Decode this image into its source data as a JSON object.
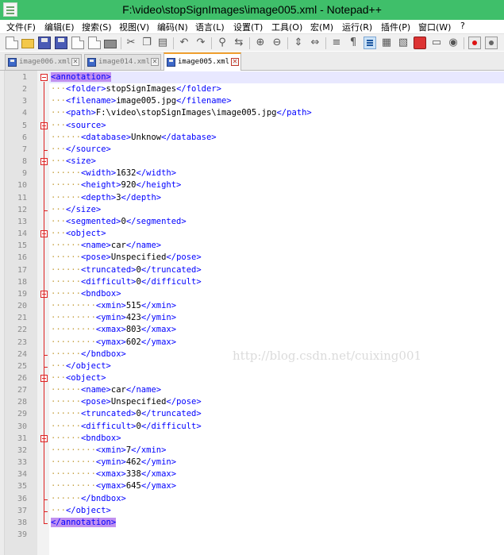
{
  "window": {
    "title": "F:\\video\\stopSignImages\\image005.xml - Notepad++"
  },
  "menu": [
    {
      "label": "文件(F)"
    },
    {
      "label": "编辑(E)"
    },
    {
      "label": "搜索(S)"
    },
    {
      "label": "视图(V)"
    },
    {
      "label": "编码(N)"
    },
    {
      "label": "语言(L)"
    },
    {
      "label": "设置(T)"
    },
    {
      "label": "工具(O)"
    },
    {
      "label": "宏(M)"
    },
    {
      "label": "运行(R)"
    },
    {
      "label": "插件(P)"
    },
    {
      "label": "窗口(W)"
    },
    {
      "label": "?"
    }
  ],
  "tabs": [
    {
      "label": "image006.xml",
      "active": false
    },
    {
      "label": "image014.xml",
      "active": false
    },
    {
      "label": "image005.xml",
      "active": true
    }
  ],
  "watermark": "http://blog.csdn.net/cuixing001",
  "lines": [
    {
      "n": "1",
      "dots": "",
      "code": "<annotation>"
    },
    {
      "n": "2",
      "dots": "···",
      "code": "<folder>stopSignImages</folder>"
    },
    {
      "n": "3",
      "dots": "···",
      "code": "<filename>image005.jpg</filename>"
    },
    {
      "n": "4",
      "dots": "···",
      "code": "<path>F:\\video\\stopSignImages\\image005.jpg</path>"
    },
    {
      "n": "5",
      "dots": "···",
      "code": "<source>"
    },
    {
      "n": "6",
      "dots": "······",
      "code": "<database>Unknow</database>"
    },
    {
      "n": "7",
      "dots": "···",
      "code": "</source>"
    },
    {
      "n": "8",
      "dots": "···",
      "code": "<size>"
    },
    {
      "n": "9",
      "dots": "······",
      "code": "<width>1632</width>"
    },
    {
      "n": "10",
      "dots": "······",
      "code": "<height>920</height>"
    },
    {
      "n": "11",
      "dots": "······",
      "code": "<depth>3</depth>"
    },
    {
      "n": "12",
      "dots": "···",
      "code": "</size>"
    },
    {
      "n": "13",
      "dots": "···",
      "code": "<segmented>0</segmented>"
    },
    {
      "n": "14",
      "dots": "···",
      "code": "<object>"
    },
    {
      "n": "15",
      "dots": "······",
      "code": "<name>car</name>"
    },
    {
      "n": "16",
      "dots": "······",
      "code": "<pose>Unspecified</pose>"
    },
    {
      "n": "17",
      "dots": "······",
      "code": "<truncated>0</truncated>"
    },
    {
      "n": "18",
      "dots": "······",
      "code": "<difficult>0</difficult>"
    },
    {
      "n": "19",
      "dots": "······",
      "code": "<bndbox>"
    },
    {
      "n": "20",
      "dots": "·········",
      "code": "<xmin>515</xmin>"
    },
    {
      "n": "21",
      "dots": "·········",
      "code": "<ymin>423</ymin>"
    },
    {
      "n": "22",
      "dots": "·········",
      "code": "<xmax>803</xmax>"
    },
    {
      "n": "23",
      "dots": "·········",
      "code": "<ymax>602</ymax>"
    },
    {
      "n": "24",
      "dots": "······",
      "code": "</bndbox>"
    },
    {
      "n": "25",
      "dots": "···",
      "code": "</object>"
    },
    {
      "n": "26",
      "dots": "···",
      "code": "<object>"
    },
    {
      "n": "27",
      "dots": "······",
      "code": "<name>car</name>"
    },
    {
      "n": "28",
      "dots": "······",
      "code": "<pose>Unspecified</pose>"
    },
    {
      "n": "29",
      "dots": "······",
      "code": "<truncated>0</truncated>"
    },
    {
      "n": "30",
      "dots": "······",
      "code": "<difficult>0</difficult>"
    },
    {
      "n": "31",
      "dots": "······",
      "code": "<bndbox>"
    },
    {
      "n": "32",
      "dots": "·········",
      "code": "<xmin>7</xmin>"
    },
    {
      "n": "33",
      "dots": "·········",
      "code": "<ymin>462</ymin>"
    },
    {
      "n": "34",
      "dots": "·········",
      "code": "<xmax>338</xmax>"
    },
    {
      "n": "35",
      "dots": "·········",
      "code": "<ymax>645</ymax>"
    },
    {
      "n": "36",
      "dots": "······",
      "code": "</bndbox>"
    },
    {
      "n": "37",
      "dots": "···",
      "code": "</object>"
    },
    {
      "n": "38",
      "dots": "",
      "code": "</annotation>"
    },
    {
      "n": "39",
      "dots": "",
      "code": ""
    }
  ],
  "colors": {
    "tag": "#0000ff",
    "text": "#000000",
    "titlebar": "#3fbf6a",
    "match_highlight": "#c090f0",
    "fold_marker": "#dd2222"
  }
}
